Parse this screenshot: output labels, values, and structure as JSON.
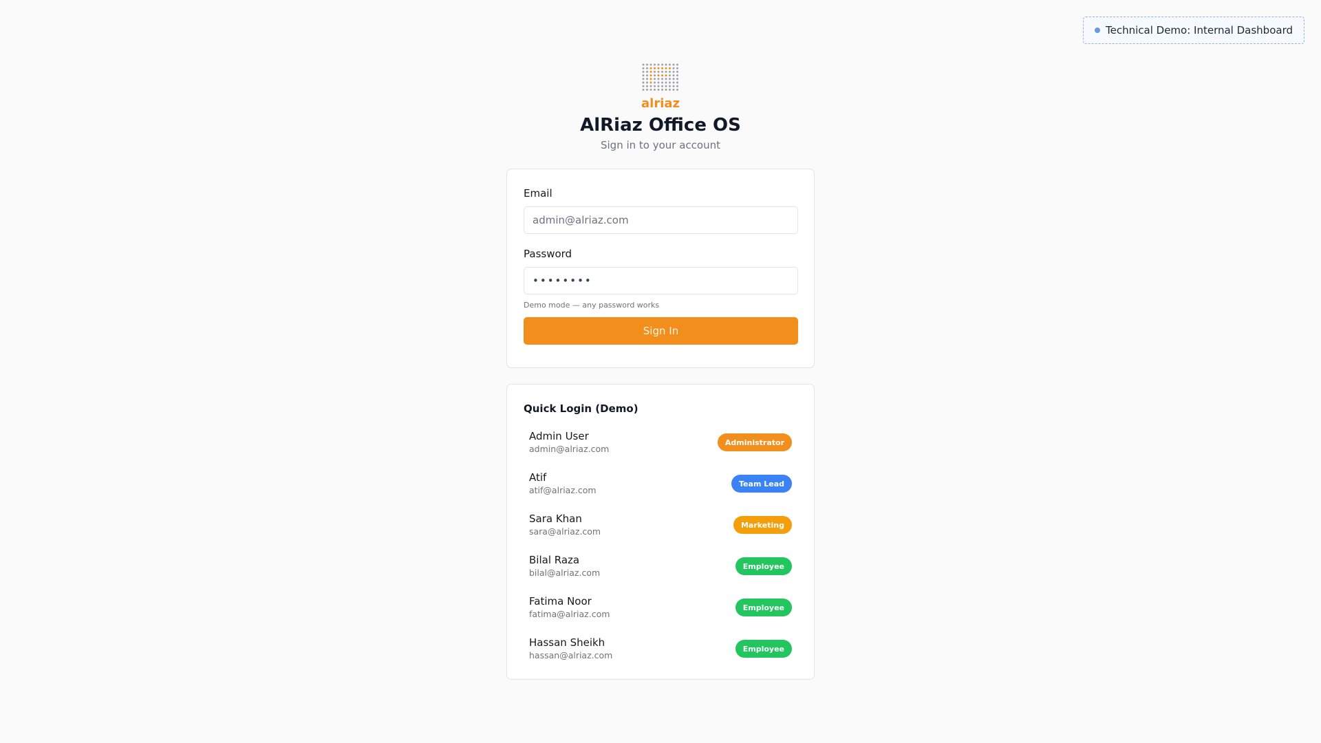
{
  "demo_badge": {
    "label": "Technical Demo: Internal Dashboard",
    "dot_color": "#6b9ae0"
  },
  "brand": {
    "logo_text": "alriaz",
    "logo_icon": "dot-grid-logo-icon",
    "title": "AlRiaz Office OS",
    "subtitle": "Sign in to your account",
    "accent_color": "#f28e1c"
  },
  "login_form": {
    "email_label": "Email",
    "email_placeholder": "admin@alriaz.com",
    "password_label": "Password",
    "password_value": "••••••••",
    "hint": "Demo mode — any password works",
    "submit_label": "Sign In"
  },
  "quick_login": {
    "title": "Quick Login (Demo)",
    "users": [
      {
        "name": "Admin User",
        "email": "admin@alriaz.com",
        "role": "Administrator",
        "role_color": "#f28e1c"
      },
      {
        "name": "Atif",
        "email": "atif@alriaz.com",
        "role": "Team Lead",
        "role_color": "#3b82f6"
      },
      {
        "name": "Sara Khan",
        "email": "sara@alriaz.com",
        "role": "Marketing",
        "role_color": "#f59e0b"
      },
      {
        "name": "Bilal Raza",
        "email": "bilal@alriaz.com",
        "role": "Employee",
        "role_color": "#22c55e"
      },
      {
        "name": "Fatima Noor",
        "email": "fatima@alriaz.com",
        "role": "Employee",
        "role_color": "#22c55e"
      },
      {
        "name": "Hassan Sheikh",
        "email": "hassan@alriaz.com",
        "role": "Employee",
        "role_color": "#22c55e"
      }
    ]
  }
}
